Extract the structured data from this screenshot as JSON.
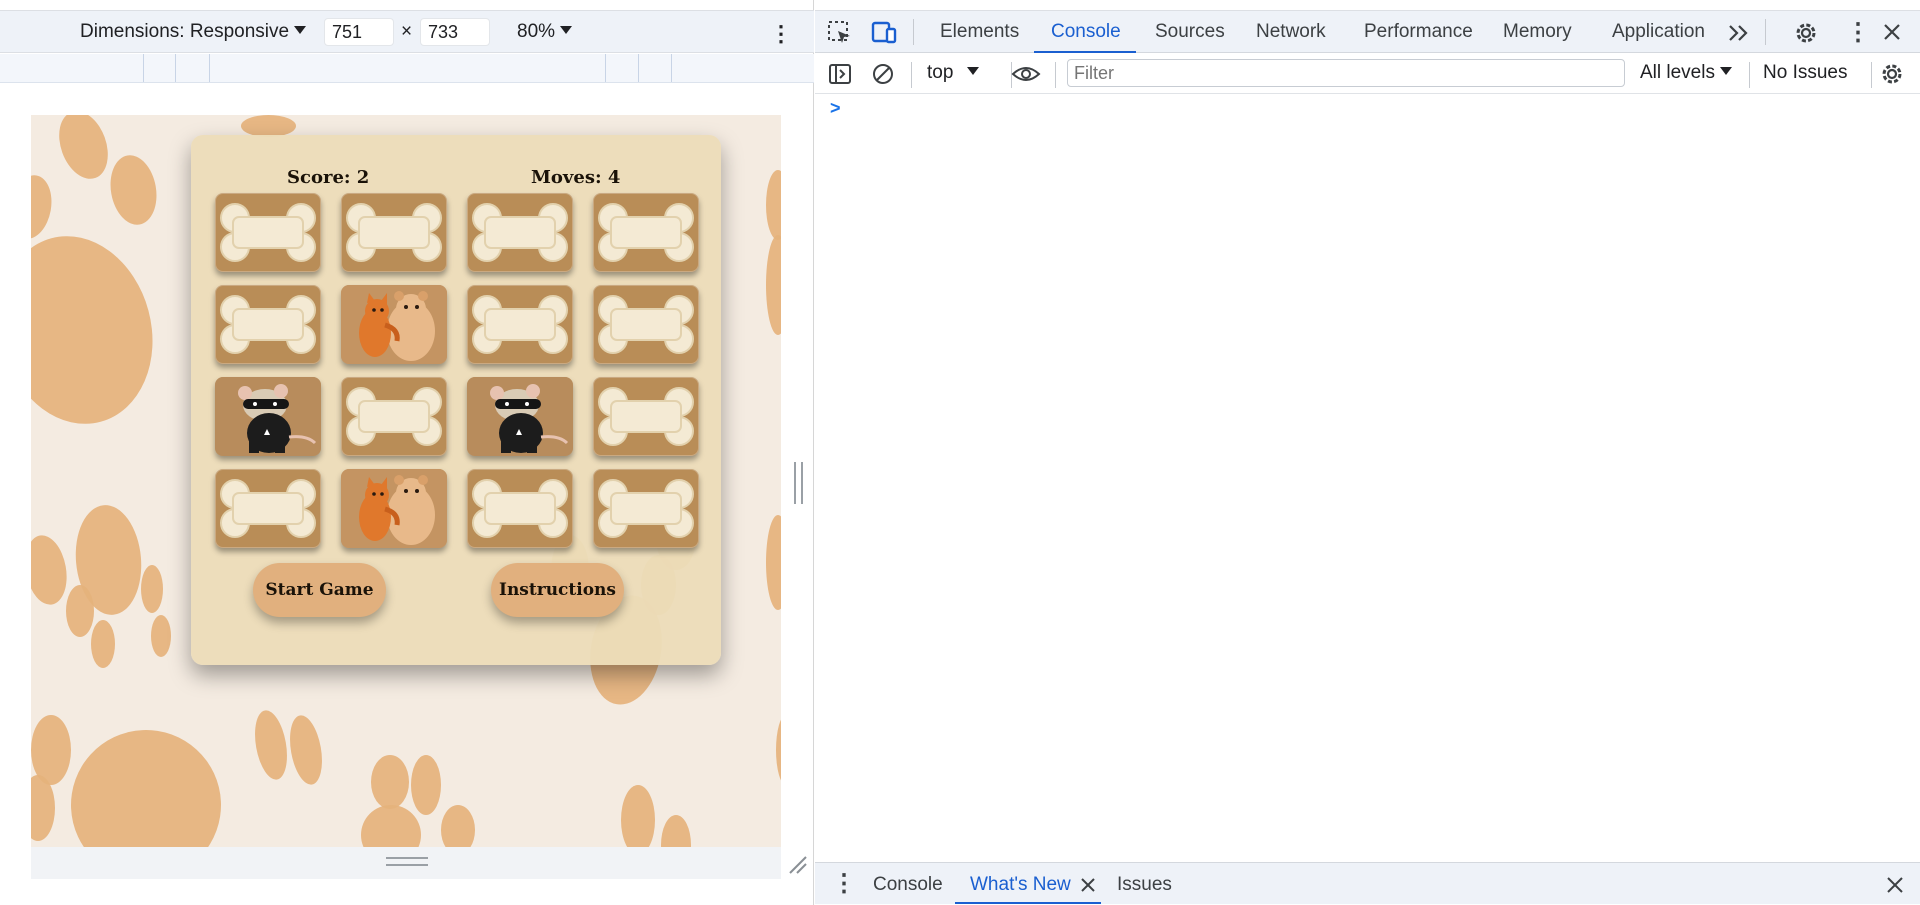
{
  "device_toolbar": {
    "dimensions_label": "Dimensions: Responsive",
    "width_value": "751",
    "height_value": "733",
    "times_sign": "×",
    "zoom_value": "80%"
  },
  "game": {
    "score_text": "Score: 2",
    "moves_text": "Moves: 4",
    "tiles": [
      "bone",
      "bone",
      "bone",
      "bone",
      "bone",
      "hugging-cat-bear",
      "bone",
      "bone",
      "masked-rat",
      "bone",
      "masked-rat",
      "bone",
      "bone",
      "hugging-cat-bear",
      "bone",
      "bone"
    ],
    "start_button": "Start Game",
    "instructions_button": "Instructions"
  },
  "devtools": {
    "tabs": [
      "Elements",
      "Console",
      "Sources",
      "Network",
      "Performance",
      "Memory",
      "Application"
    ],
    "active_tab": "Console",
    "context_select": "top",
    "filter_placeholder": "Filter",
    "levels_select": "All levels",
    "issues_text": "No Issues",
    "prompt_symbol": ">",
    "drawer_tabs": [
      "Console",
      "What's New",
      "Issues"
    ],
    "active_drawer_tab": "What's New"
  },
  "colors": {
    "accent": "#1a5fd0",
    "paw": "#e5b27c",
    "card": "#ecdcb8",
    "tile": "#b98d57",
    "button": "#e1b07e"
  }
}
